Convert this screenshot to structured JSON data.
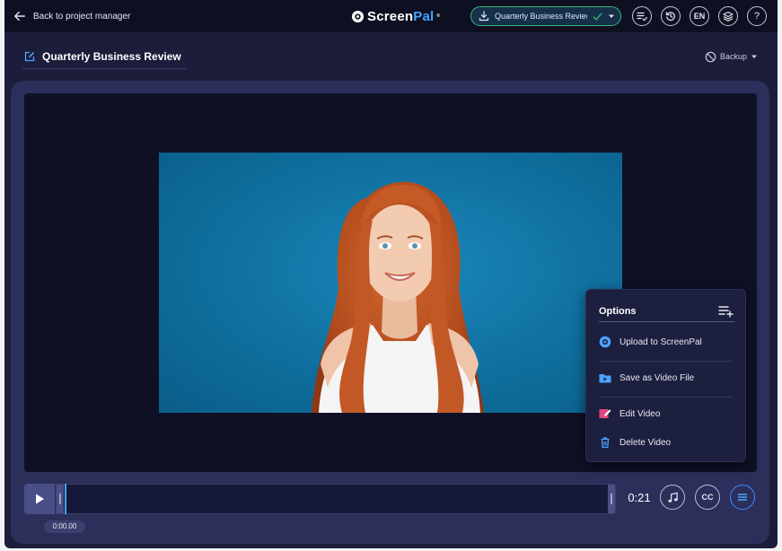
{
  "topbar": {
    "back_label": "Back to project manager",
    "logo_part1": "Screen",
    "logo_part2": "Pal",
    "logo_reg": "®",
    "project_pill_text": "Quarterly Business Review",
    "lang_label": "EN",
    "help_label": "?"
  },
  "header": {
    "project_title": "Quarterly Business Review",
    "backup_label": "Backup"
  },
  "options_menu": {
    "title": "Options",
    "items": [
      {
        "label": "Upload to ScreenPal",
        "icon": "screenpal-upload-icon",
        "color": "#4ea3ff"
      },
      {
        "label": "Save as Video File",
        "icon": "folder-video-icon",
        "color": "#4ea3ff"
      },
      {
        "label": "Edit Video",
        "icon": "edit-video-icon",
        "color": "#e0457b"
      },
      {
        "label": "Delete Video",
        "icon": "trash-icon",
        "color": "#4ea3ff"
      }
    ]
  },
  "timeline": {
    "current_time": "0:00.00",
    "duration": "0:21",
    "cc_label": "CC"
  },
  "colors": {
    "accent": "#4ea3ff",
    "success": "#35b779",
    "background": "#1b1d3a",
    "video_bg": "#0f6f9e"
  }
}
